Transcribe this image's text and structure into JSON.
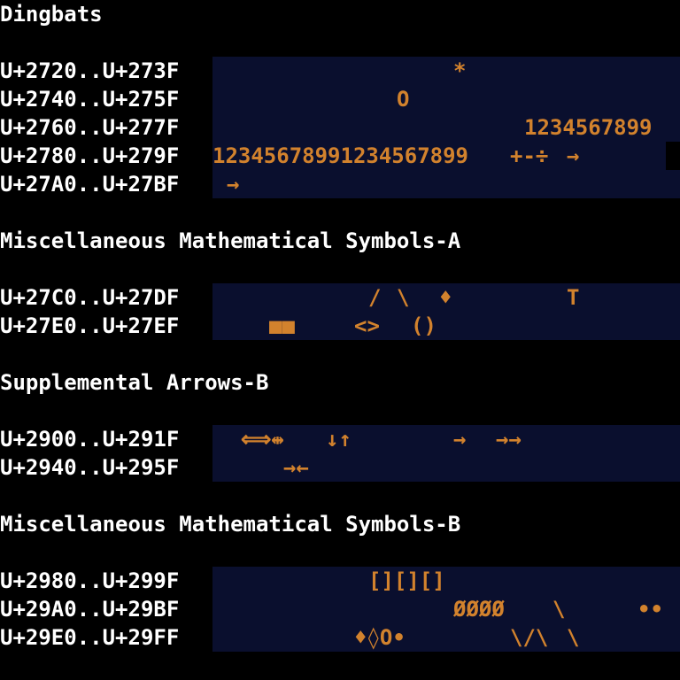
{
  "colors": {
    "background": "#000000",
    "row_background": "#0a0f2e",
    "label_text": "#ffffff",
    "glyph_text": "#d2822d",
    "missing_glyph_block": "#000000"
  },
  "sections": [
    {
      "title": "Dingbats",
      "rows": [
        {
          "label": "U+2720..U+273F",
          "glyphs": [
            "*"
          ]
        },
        {
          "label": "U+2740..U+275F",
          "glyphs": [
            "O"
          ]
        },
        {
          "label": "U+2760..U+277F",
          "glyphs": [
            "1234567899"
          ]
        },
        {
          "label": "U+2780..U+279F",
          "glyphs": [
            "12345678991234567899",
            "+-÷",
            "→"
          ]
        },
        {
          "label": "U+27A0..U+27BF",
          "glyphs": [
            "→"
          ]
        }
      ]
    },
    {
      "title": "Miscellaneous Mathematical Symbols-A",
      "rows": [
        {
          "label": "U+27C0..U+27DF",
          "glyphs": [
            "/",
            "\\",
            "♦",
            "T"
          ]
        },
        {
          "label": "U+27E0..U+27EF",
          "glyphs": [
            "■■",
            "<>",
            "()"
          ]
        }
      ]
    },
    {
      "title": "Supplemental Arrows-B",
      "rows": [
        {
          "label": "U+2900..U+291F",
          "glyphs": [
            "⟺⇹",
            "↓↑",
            "→",
            "→→"
          ]
        },
        {
          "label": "U+2940..U+295F",
          "glyphs": [
            "→←"
          ]
        }
      ]
    },
    {
      "title": "Miscellaneous Mathematical Symbols-B",
      "rows": [
        {
          "label": "U+2980..U+299F",
          "glyphs": [
            "[][][]"
          ]
        },
        {
          "label": "U+29A0..U+29BF",
          "glyphs": [
            "ØØØØ",
            "\\",
            "••"
          ]
        },
        {
          "label": "U+29E0..U+29FF",
          "glyphs": [
            "♦◊O•",
            "\\/\\",
            "\\"
          ]
        }
      ]
    }
  ]
}
